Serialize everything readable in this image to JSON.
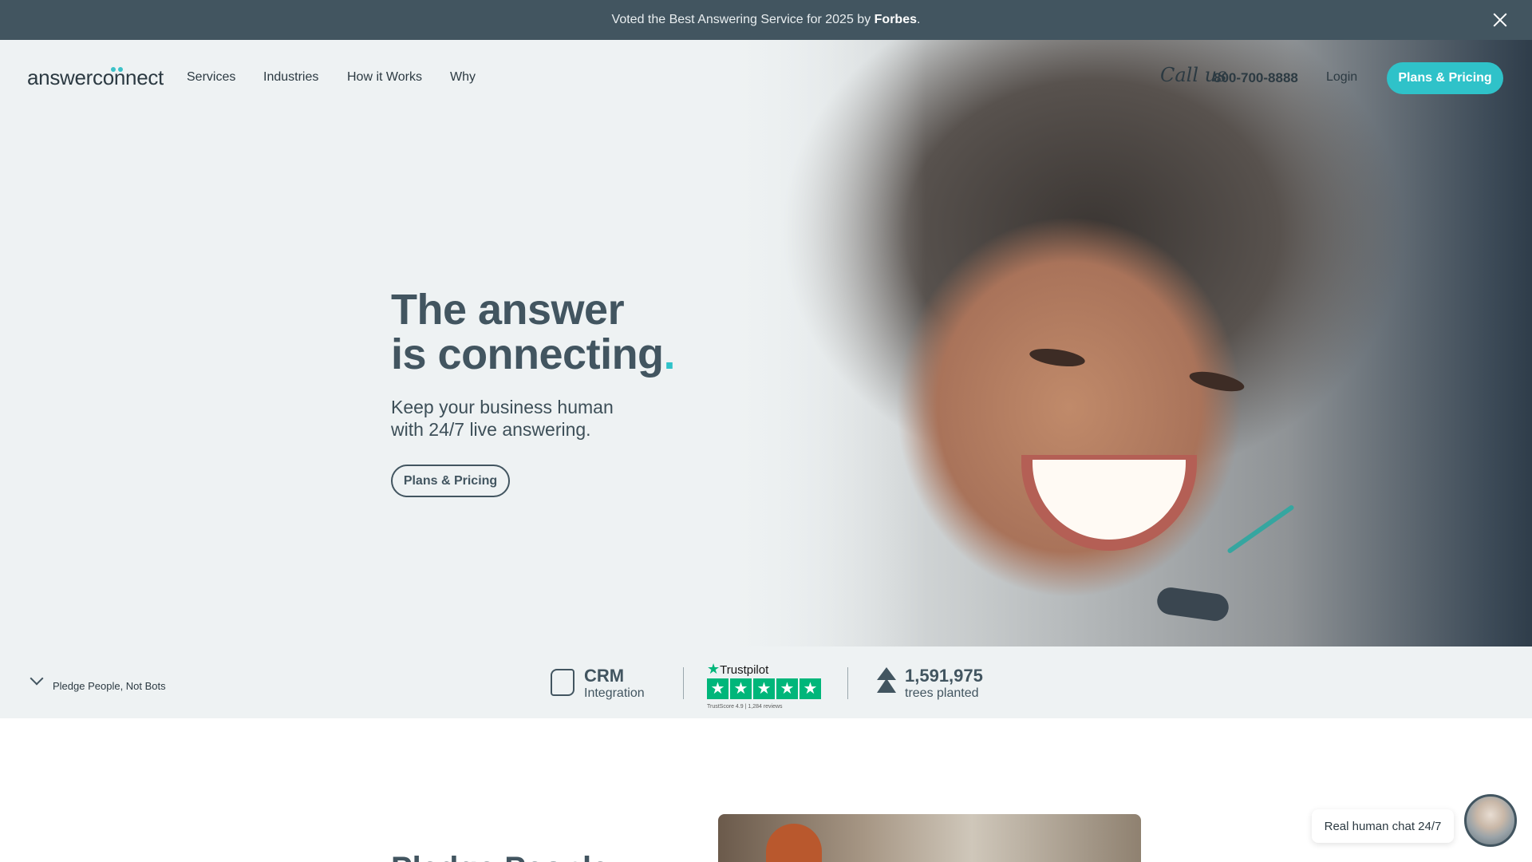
{
  "announcement": {
    "text_pre": "Voted the Best Answering Service for 2025 by ",
    "text_bold": "Forbes",
    "text_post": "."
  },
  "nav": {
    "logo": "answerconnect",
    "links": [
      "Services",
      "Industries",
      "How it Works",
      "Why"
    ],
    "call_us": "Call us",
    "phone": "800-700-8888",
    "login": "Login",
    "cta": "Plans & Pricing"
  },
  "hero": {
    "headline_line1": "The answer",
    "headline_line2": "is connecting",
    "headline_dot": ".",
    "subline": "Keep your business human with 24/7 live answering.",
    "cta": "Plans & Pricing"
  },
  "stats": {
    "pledge": "Pledge People, Not Bots",
    "crm_title": "CRM",
    "crm_sub": "Integration",
    "trustpilot_logo": "Trustpilot",
    "trustpilot_rating": 5,
    "trustpilot_score": "TrustScore 4.9 | 1,284 reviews",
    "trees_count": "1,591,975",
    "trees_label": "trees planted"
  },
  "below": {
    "title": "Pledge People"
  },
  "chat": {
    "label": "Real human chat 24/7"
  },
  "colors": {
    "accent": "#2fc2c9",
    "dark": "#425560",
    "announce_bg": "#425560",
    "trustpilot": "#00b67a"
  },
  "icons": [
    "close-icon",
    "chevron-down-icon",
    "puzzle-icon",
    "trustpilot-star-icon",
    "tree-icon"
  ]
}
